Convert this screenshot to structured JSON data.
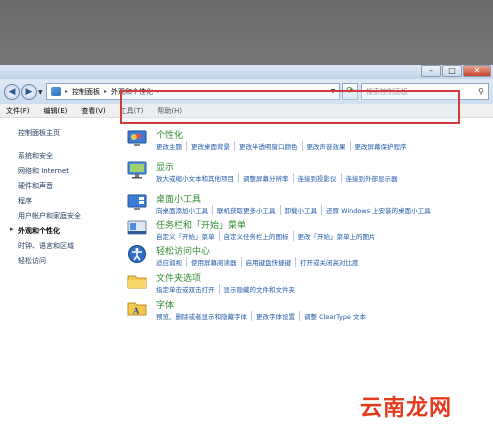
{
  "window": {
    "buttons": {
      "minimize": "–",
      "maximize": "□",
      "close": "✕"
    }
  },
  "addressbar": {
    "back": "◀",
    "forward": "▶",
    "breadcrumb": [
      "控制面板",
      "外观和个性化"
    ],
    "search_placeholder": "搜索控制面板",
    "icons": {
      "back": "arrow-left-icon",
      "forward": "arrow-right-icon",
      "refresh": "refresh-icon",
      "search": "search-icon"
    }
  },
  "menu": {
    "items": [
      {
        "label": "文件",
        "key": "(F)"
      },
      {
        "label": "编辑",
        "key": "(E)"
      },
      {
        "label": "查看",
        "key": "(V)"
      },
      {
        "label": "工具",
        "key": "(T)"
      },
      {
        "label": "帮助",
        "key": "(H)"
      }
    ]
  },
  "sidebar": {
    "home": "控制面板主页",
    "items": [
      "系统和安全",
      "网络和 Internet",
      "硬件和声音",
      "程序",
      "用户帐户和家庭安全",
      "外观和个性化",
      "时钟、语言和区域",
      "轻松访问"
    ],
    "current_index": 5
  },
  "categories": [
    {
      "title": "个性化",
      "icon": "personalization-icon",
      "links": [
        "更改主题",
        "更改桌面背景",
        "更改半透明窗口颜色",
        "更改声音效果",
        "更改屏幕保护程序"
      ]
    },
    {
      "title": "显示",
      "icon": "display-icon",
      "links": [
        "放大或缩小文本和其他项目",
        "调整屏幕分辨率",
        "连接到投影仪",
        "连接到外部显示器"
      ]
    },
    {
      "title": "桌面小工具",
      "icon": "gadgets-icon",
      "links": [
        "向桌面添加小工具",
        "联机获取更多小工具",
        "卸载小工具",
        "还原 Windows 上安装的桌面小工具"
      ]
    },
    {
      "title": "任务栏和「开始」菜单",
      "icon": "taskbar-icon",
      "links": [
        "自定义「开始」菜单",
        "自定义任务栏上的图标",
        "更改「开始」菜单上的图片"
      ]
    },
    {
      "title": "轻松访问中心",
      "icon": "ease-of-access-icon",
      "links": [
        "适应弱视",
        "使用屏幕阅读器",
        "启用键盘快捷键",
        "打开或关闭高对比度"
      ]
    },
    {
      "title": "文件夹选项",
      "icon": "folder-options-icon",
      "links": [
        "指定单击或双击打开",
        "显示隐藏的文件和文件夹"
      ]
    },
    {
      "title": "字体",
      "icon": "fonts-icon",
      "links": [
        "预览、删除或者显示和隐藏字体",
        "更改字体设置",
        "调整 ClearType 文本"
      ]
    }
  ],
  "watermark": "云南龙网",
  "colors": {
    "title_green": "#2f8b2f",
    "link_blue": "#1e5aa8",
    "highlight_red": "#d23a3a",
    "watermark": "#e13a1c"
  }
}
